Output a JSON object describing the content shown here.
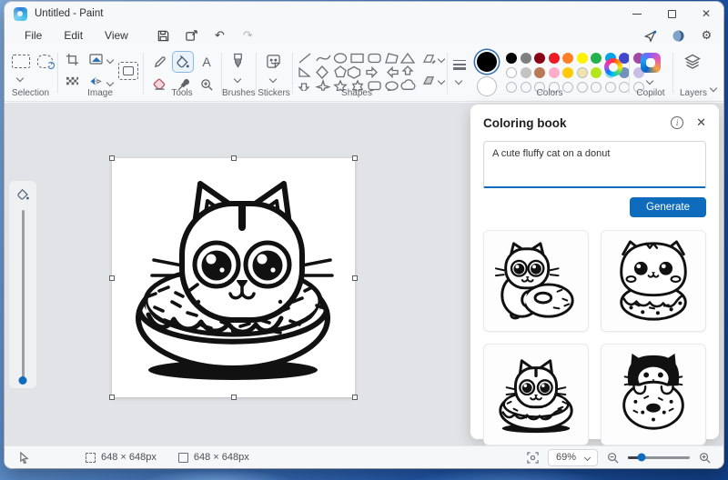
{
  "window": {
    "title": "Untitled - Paint"
  },
  "menu": {
    "items": [
      "File",
      "Edit",
      "View"
    ]
  },
  "ribbon": {
    "labels": {
      "selection": "Selection",
      "image": "Image",
      "tools": "Tools",
      "brushes": "Brushes",
      "stickers": "Stickers",
      "shapes": "Shapes",
      "colors": "Colors",
      "copilot": "Copilot",
      "layers": "Layers"
    }
  },
  "palette": {
    "accent": "#0f6cbd",
    "selected_foreground": "#000000",
    "selected_background": "#ffffff",
    "row1": [
      "#000000",
      "#7f7f7f",
      "#880015",
      "#ed1c24",
      "#ff7f27",
      "#fff200",
      "#22b14c",
      "#00a2e8",
      "#3f48cc",
      "#a349a4"
    ],
    "row2": [
      "#ffffff",
      "#c3c3c3",
      "#b97a57",
      "#ffaec9",
      "#ffc90e",
      "#efe4b0",
      "#b5e61d",
      "#99d9ea",
      "#7092be",
      "#c8bfe7"
    ],
    "empty_slots": 10
  },
  "coloring_book": {
    "title": "Coloring book",
    "prompt": "A cute fluffy cat on a donut",
    "generate_label": "Generate",
    "thumbnails": [
      {
        "label": "cat hugging a donut"
      },
      {
        "label": "fluffy round cat on a donut"
      },
      {
        "label": "cat head inside a sprinkled donut"
      },
      {
        "label": "tuxedo cat peeking over a donut"
      }
    ]
  },
  "canvas": {
    "description": "line drawing of a cute cat sitting in a sprinkled donut"
  },
  "statusbar": {
    "selection_size": "648 × 648px",
    "canvas_size": "648 × 648px",
    "zoom": "69%"
  }
}
